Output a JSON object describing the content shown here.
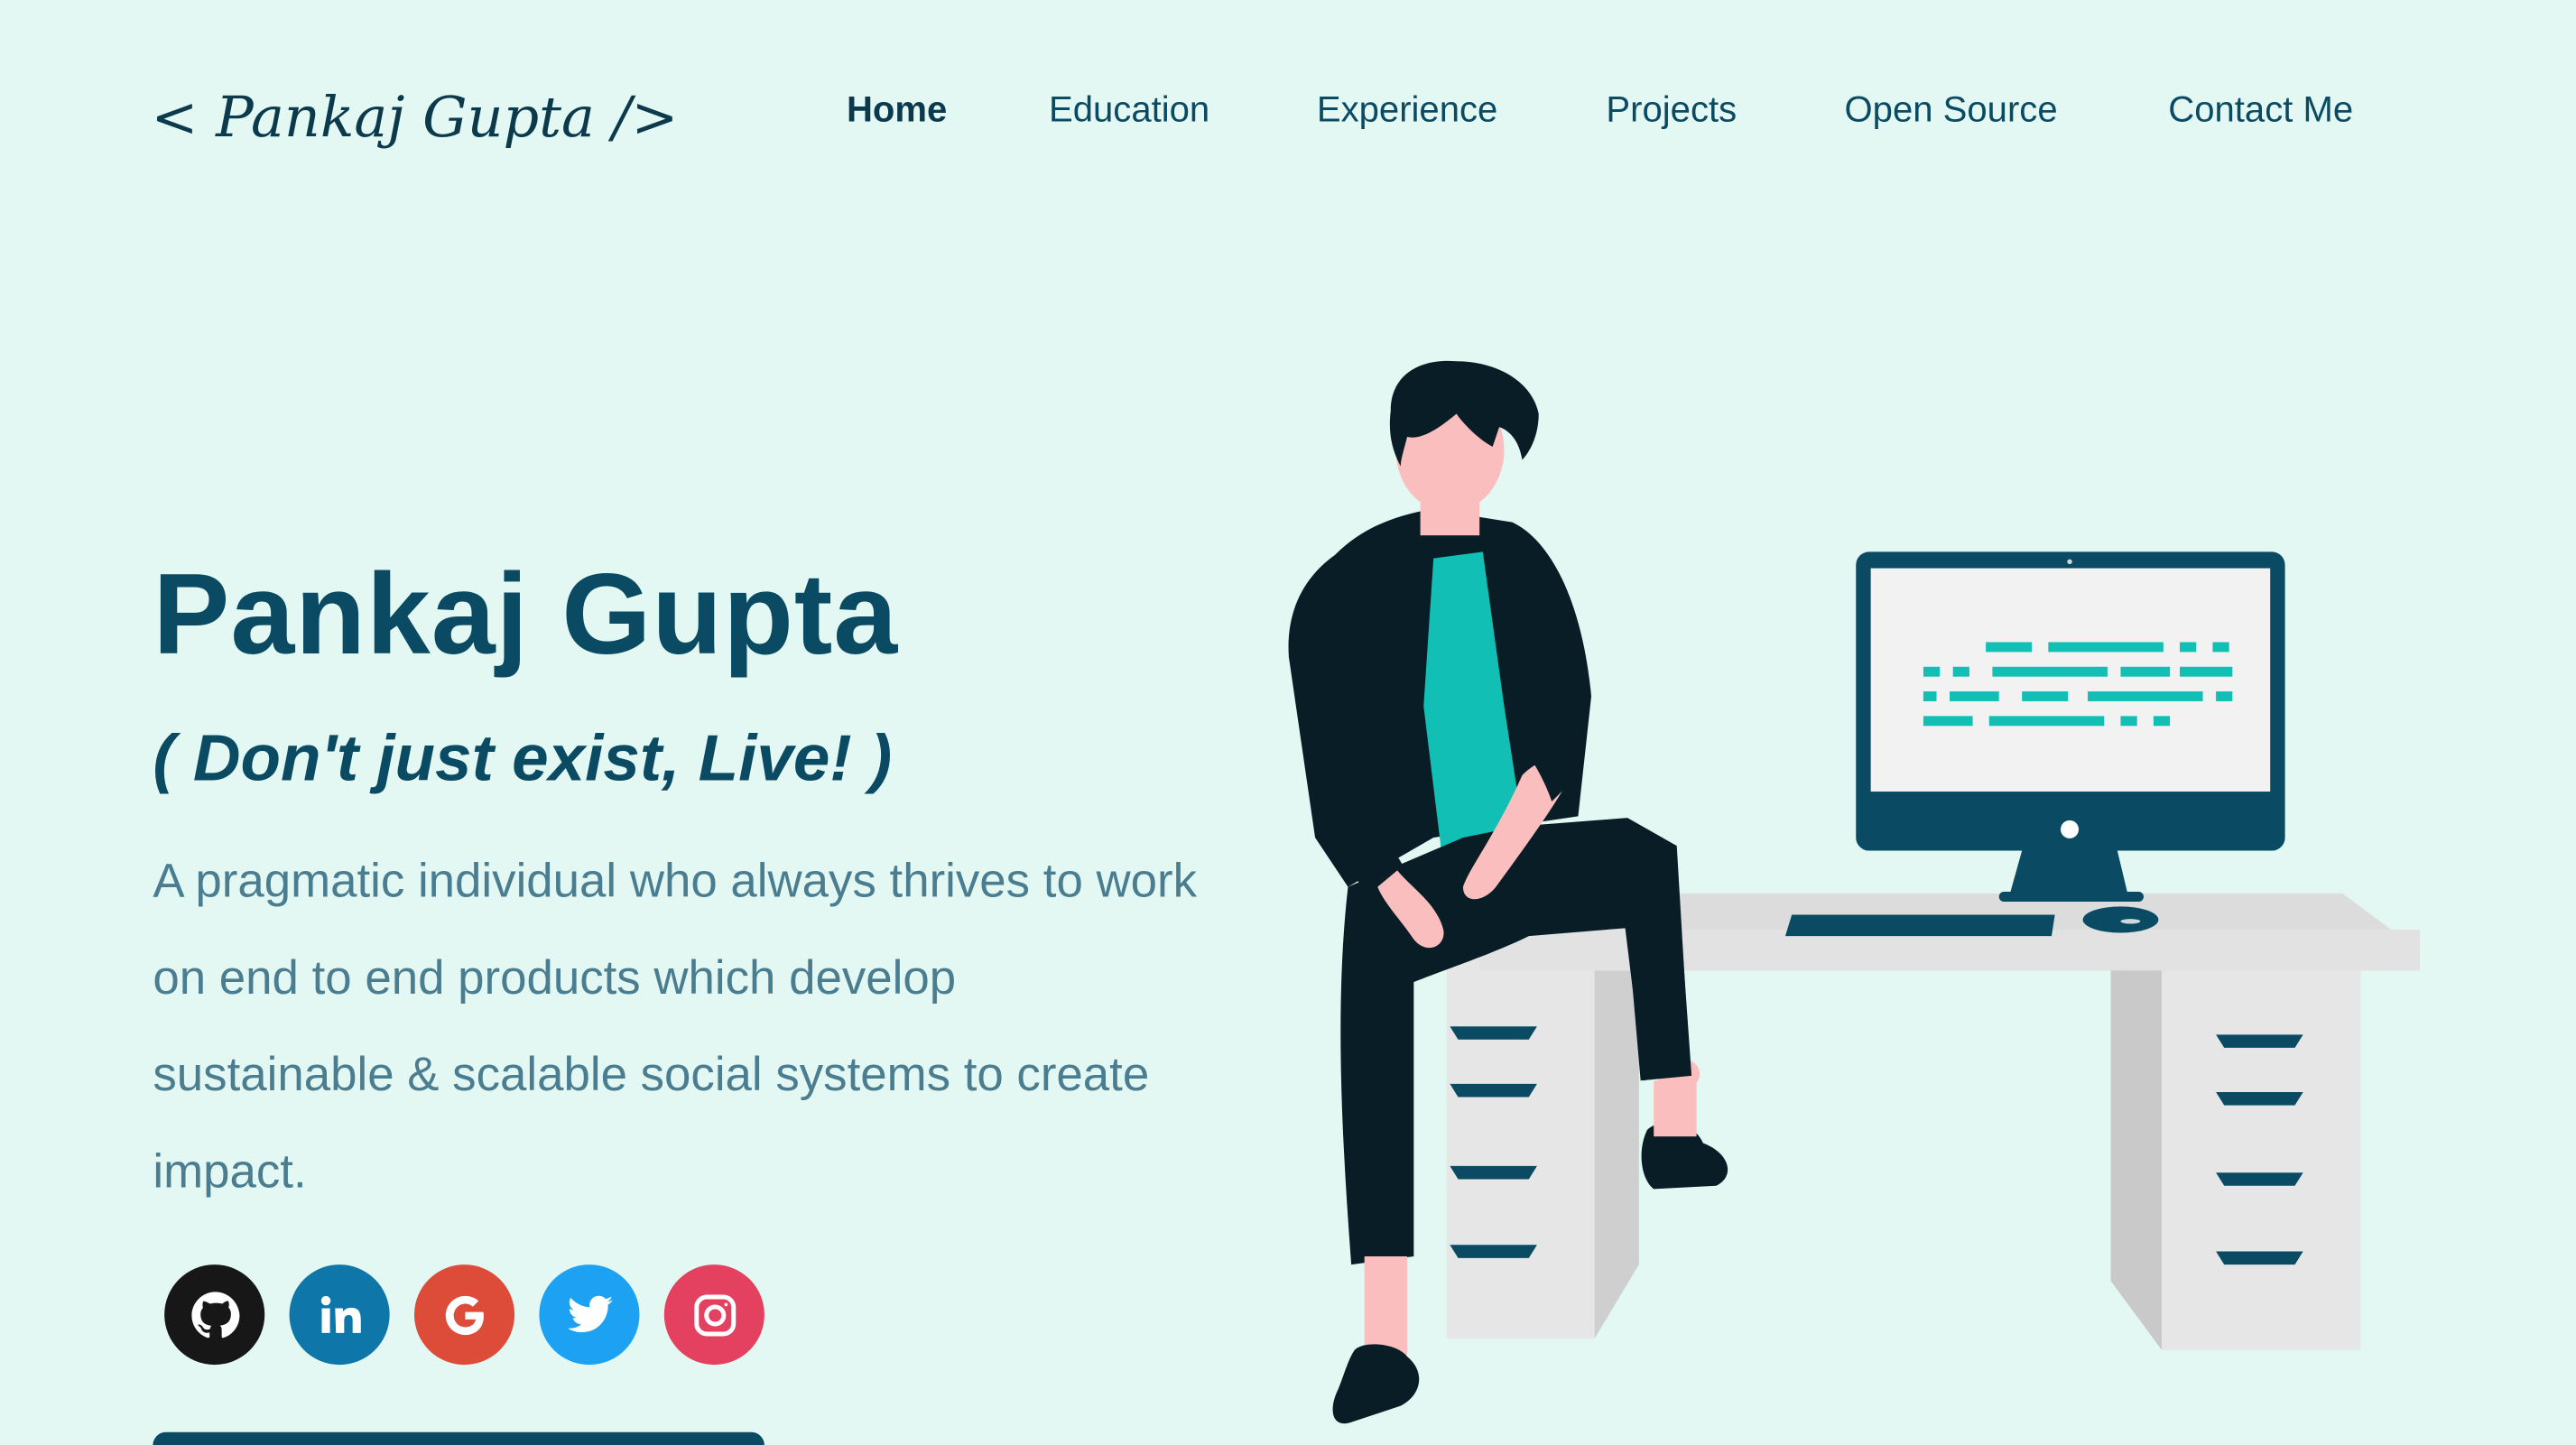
{
  "header": {
    "logo_text": "< Pankaj Gupta />",
    "nav": [
      {
        "label": "Home",
        "active": true
      },
      {
        "label": "Education",
        "active": false
      },
      {
        "label": "Experience",
        "active": false
      },
      {
        "label": "Projects",
        "active": false
      },
      {
        "label": "Open Source",
        "active": false
      },
      {
        "label": "Contact Me",
        "active": false
      }
    ]
  },
  "hero": {
    "title": "Pankaj Gupta",
    "subtitle": "( Don't just exist, Live! )",
    "description": "A pragmatic individual who always thrives to work on end to end products which develop sustainable & scalable social systems to create impact."
  },
  "social": [
    {
      "name": "github-icon",
      "color": "#181717"
    },
    {
      "name": "linkedin-icon",
      "color": "#0e76a8"
    },
    {
      "name": "google-icon",
      "color": "#dd4b39"
    },
    {
      "name": "twitter-icon",
      "color": "#1da1f2"
    },
    {
      "name": "instagram-icon",
      "color": "#e4405f"
    }
  ],
  "colors": {
    "background": "#e3f8f3",
    "primary": "#0b4a63",
    "accent": "#12bfb5",
    "text_muted": "#4b7d91"
  }
}
